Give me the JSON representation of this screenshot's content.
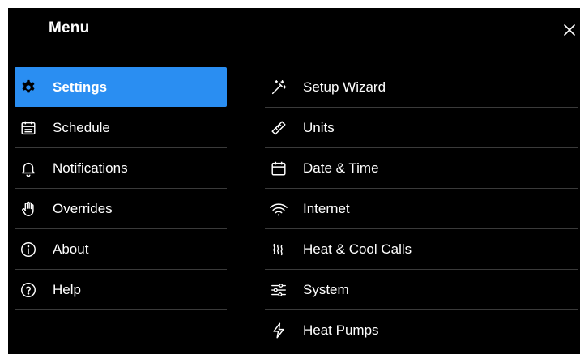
{
  "header": {
    "title": "Menu",
    "close_icon": "close-icon"
  },
  "sidebar": {
    "items": [
      {
        "label": "Settings",
        "icon": "gear-icon",
        "active": true
      },
      {
        "label": "Schedule",
        "icon": "calendar-grid-icon"
      },
      {
        "label": "Notifications",
        "icon": "bell-icon"
      },
      {
        "label": "Overrides",
        "icon": "hand-icon"
      },
      {
        "label": "About",
        "icon": "info-icon"
      },
      {
        "label": "Help",
        "icon": "help-icon"
      }
    ]
  },
  "settings": {
    "items": [
      {
        "label": "Setup Wizard",
        "icon": "magic-wand-icon"
      },
      {
        "label": "Units",
        "icon": "ruler-icon"
      },
      {
        "label": "Date & Time",
        "icon": "calendar-icon"
      },
      {
        "label": "Internet",
        "icon": "wifi-icon"
      },
      {
        "label": "Heat & Cool Calls",
        "icon": "heat-waves-icon"
      },
      {
        "label": "System",
        "icon": "sliders-icon"
      },
      {
        "label": "Heat Pumps",
        "icon": "lightning-icon"
      }
    ]
  },
  "colors": {
    "background": "#000000",
    "accent": "#2a8ef2",
    "divider": "#3a3a3a",
    "text": "#ffffff"
  }
}
